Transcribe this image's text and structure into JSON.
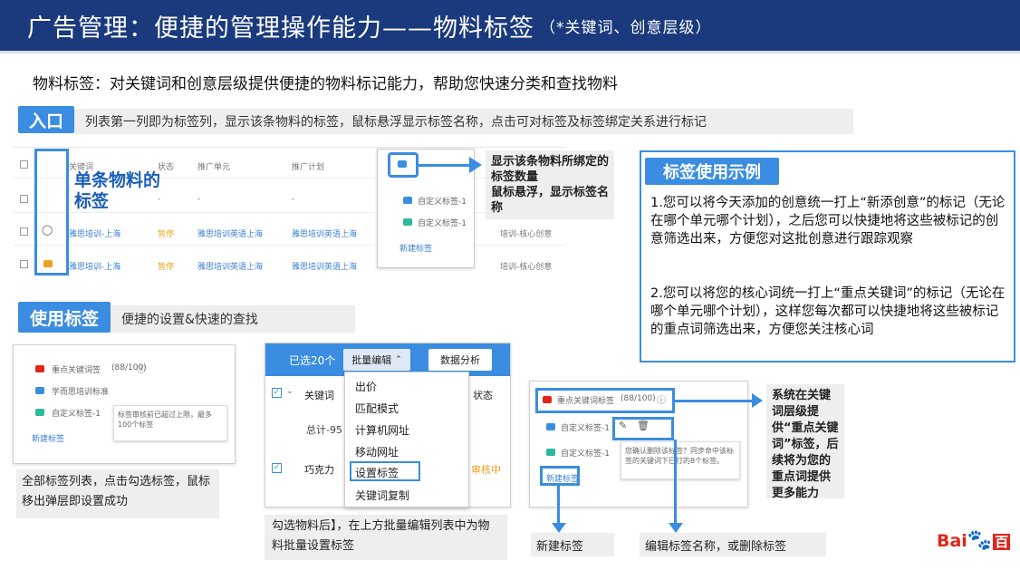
{
  "header": {
    "title": "广告管理：便捷的管理操作能力——物料标签",
    "subtitle": "（*关键词、创意层级）"
  },
  "intro": "物料标签：对关键词和创意层级提供便捷的物料标记能力，帮助您快速分类和查找物料",
  "entry": {
    "label": "入口",
    "description": "列表第一列即为标签列，显示该条物料的标签，鼠标悬浮显示标签名称，点击可对标签及标签绑定关系进行标记"
  },
  "table_mock": {
    "headers": [
      "关键词",
      "状态",
      "推广单元",
      "推广计划"
    ],
    "rows": [
      {
        "keyword": "-",
        "status": "-",
        "unit": "-",
        "plan": "-"
      },
      {
        "keyword": "雅思培训-上海",
        "status": "暂停",
        "unit": "雅思培训英语上海",
        "plan": "雅思培训英语上海",
        "extra": "培训-核心创意"
      },
      {
        "keyword": "雅思培训-上海",
        "status": "暂停",
        "unit": "雅思培训英语上海",
        "plan": "雅思培训英语上海",
        "extra": "培训-核心创意"
      }
    ],
    "single_label": "单条物料的标签"
  },
  "tag_popup": {
    "items": [
      "自定义标签-1",
      "自定义标签-1"
    ],
    "new_link": "新建标签"
  },
  "tag_count_note": "显示该条物料所绑定的标签数量\n鼠标悬浮，显示标签名称",
  "example": {
    "title": "标签使用示例",
    "para1": "1.您可以将今天添加的创意统一打上“新添创意”的标记（无论在哪个单元哪个计划），之后您可以快捷地将这些被标记的创意筛选出来，方便您对这批创意进行跟踪观察",
    "para2": "2.您可以将您的核心词统一打上“重点关键词”的标记（无论在哪个单元哪个计划），这样您每次都可以快捷地将这些被标记的重点词筛选出来，方便您关注核心词"
  },
  "usage": {
    "label": "使用标签",
    "description": "便捷的设置&快速的查找"
  },
  "panel1": {
    "tags": [
      "重点关键词签",
      "学而思培训标准",
      "自定义标签-1"
    ],
    "count": "(88/100)",
    "tooltip": "标签审核前已超过上限，最多100个标签",
    "new_link": "新建标签",
    "note": "全部标签列表，点击勾选标签，鼠标移出弹层即设置成功"
  },
  "panel2": {
    "selected": "已选20个",
    "batch_edit": "批量编辑",
    "analyze": "数据分析",
    "col_keyword": "关键词",
    "col_status": "状态",
    "row1": "总计-95",
    "row2": "巧克力",
    "row2_status": "审核中",
    "menu": [
      "出价",
      "匹配模式",
      "计算机网址",
      "移动网址",
      "设置标签",
      "关键词复制"
    ],
    "note": "勾选物料后】，在上方批量编辑列表中为物料批量设置标签"
  },
  "panel3": {
    "tags": [
      "重点关键词标签",
      "自定义标签-1",
      "自定义标签-1"
    ],
    "count": "(88/100)",
    "note_text": "您确认删除该标签？同步命中该标签的关键词下已打的8个标签。",
    "new_link": "新建标签"
  },
  "sys_note": "系统在关键词层级提供“重点关键词”标签，后续将为您的重点词提供更多能力",
  "new_tag_note": "新建标签",
  "edit_tag_note": "编辑标签名称，或删除标签",
  "logo": {
    "text": "Bai",
    "du": "百"
  },
  "colors": {
    "header": "#1a3a7d",
    "accent": "#3a8de0",
    "note_bg": "#eeeeee"
  }
}
